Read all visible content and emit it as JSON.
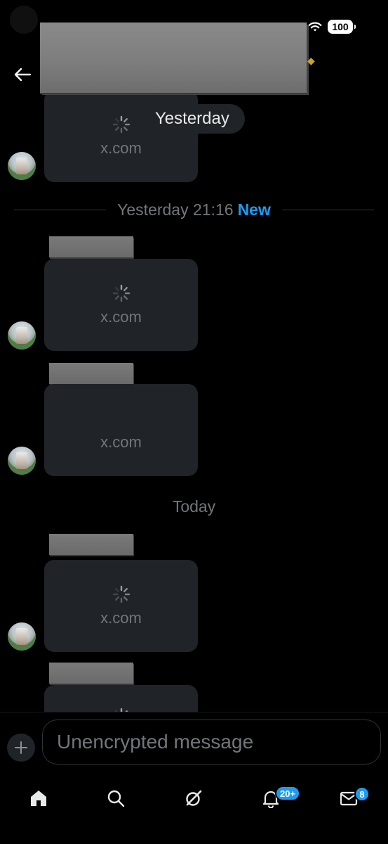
{
  "status_bar": {
    "battery": "100"
  },
  "chat": {
    "date_chip": "Yesterday",
    "new_divider": {
      "label": "Yesterday 21:16",
      "new": "New"
    },
    "today_label": "Today",
    "link_domain": "x.com"
  },
  "composer": {
    "placeholder": "Unencrypted message"
  },
  "nav": {
    "notifications_badge": "20+",
    "messages_badge": "8"
  },
  "colors": {
    "accent": "#1d9bf0",
    "card_bg": "#202327",
    "muted_text": "#71767b"
  }
}
